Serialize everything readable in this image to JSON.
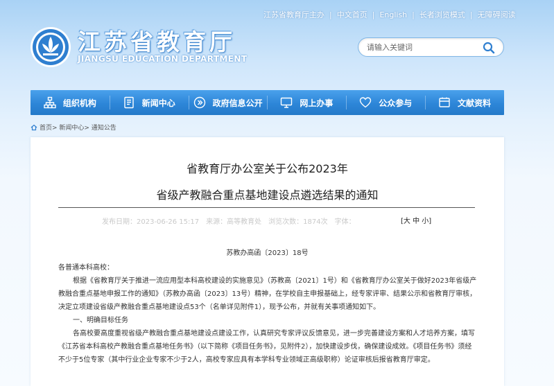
{
  "top_links": [
    "江苏省教育厅主办",
    "中文首页",
    "English",
    "长者浏览模式",
    "无障碍阅读"
  ],
  "brand": {
    "title_cn": "江苏省教育厅",
    "title_en": "JIANGSU EDUCATION DEPARTMENT"
  },
  "search": {
    "placeholder": "请输入关键词",
    "value": ""
  },
  "nav": [
    {
      "label": "组织机构",
      "icon": "org-chart-icon"
    },
    {
      "label": "新闻中心",
      "icon": "document-icon"
    },
    {
      "label": "政府信息公开",
      "icon": "chevron-circle-icon"
    },
    {
      "label": "网上办事",
      "icon": "monitor-icon"
    },
    {
      "label": "公众参与",
      "icon": "heart-icon"
    },
    {
      "label": "文献资料",
      "icon": "book-icon"
    }
  ],
  "breadcrumb": "首页> 新闻中心> 通知公告",
  "article": {
    "title_line1": "省教育厅办公室关于公布2023年",
    "title_line2": "省级产教融合重点基地建设点遴选结果的通知",
    "meta": [
      "发布日期：2023-06-26 15:17",
      "来源：高等教育处",
      "浏览次数：1874次",
      "字体："
    ],
    "font_size": "[大 中 小]",
    "doc_no": "苏教办高函〔2023〕18号",
    "greeting": "各普通本科高校：",
    "para1": "根据《省教育厅关于推进一流应用型本科高校建设的实施意见》（苏教高〔2021〕1号）和《省教育厅办公室关于做好2023年省级产教融合重点基地申报工作的通知》（苏教办高函〔2023〕13号）精神，在学校自主申报基础上，经专家评审、结果公示和省教育厅审核，决定立项建设省级产教融合重点基地建设点53个（名单详见附件1），现予公布，并就有关事项通知如下。",
    "section1": "一、明确目标任务",
    "para2": "各高校要高度重视省级产教融合重点基地建设点建设工作，认真研究专家评议反馈意见，进一步完善建设方案和人才培养方案，填写《江苏省本科高校产教融合重点基地任务书》（以下简称《项目任务书》，见附件2），加快建设步伐，确保建设成效。《项目任务书》须经不少于5位专家（其中行业企业专家不少于2人，高校专家应具有本学科专业领域正高级职称）论证审核后报省教育厅审定。"
  },
  "colors": {
    "nav_blue": "#2d86d8",
    "brand_blue": "#2a77c6"
  }
}
